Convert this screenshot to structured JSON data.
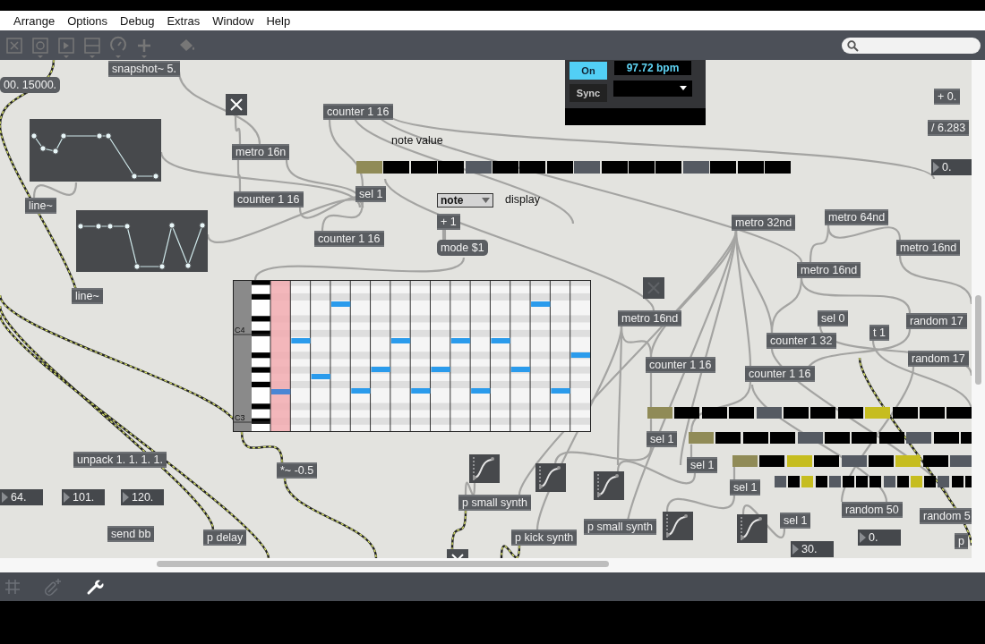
{
  "menu": [
    "Arrange",
    "Options",
    "Debug",
    "Extras",
    "Window",
    "Help"
  ],
  "transport": {
    "buttons": [
      {
        "label": "On",
        "selected": true
      },
      {
        "label": "Sync",
        "selected": false
      }
    ],
    "tempo": "97.72 bpm"
  },
  "comments": [
    "note value",
    "display"
  ],
  "umenu": {
    "value": "note"
  },
  "objects": [
    {
      "kind": "object",
      "text": "snapshot~ 5."
    },
    {
      "kind": "message",
      "text": "00. 15000."
    },
    {
      "kind": "object",
      "text": "counter 1 16"
    },
    {
      "kind": "object",
      "text": "metro 16n"
    },
    {
      "kind": "object",
      "text": "counter 1 16"
    },
    {
      "kind": "object",
      "text": "sel 1"
    },
    {
      "kind": "object",
      "text": "line~"
    },
    {
      "kind": "object",
      "text": "counter 1 16"
    },
    {
      "kind": "object",
      "text": "+ 1"
    },
    {
      "kind": "message",
      "text": "mode $1"
    },
    {
      "kind": "object",
      "text": "line~"
    },
    {
      "kind": "object",
      "text": "metro 32nd"
    },
    {
      "kind": "object",
      "text": "metro 64nd"
    },
    {
      "kind": "object",
      "text": "metro 16nd"
    },
    {
      "kind": "object",
      "text": "metro 16nd"
    },
    {
      "kind": "object",
      "text": "metro 16nd"
    },
    {
      "kind": "object",
      "text": "sel 0"
    },
    {
      "kind": "object",
      "text": "random 17"
    },
    {
      "kind": "object",
      "text": "t 1"
    },
    {
      "kind": "object",
      "text": "counter 1 32"
    },
    {
      "kind": "object",
      "text": "random 17"
    },
    {
      "kind": "object",
      "text": "counter 1 16"
    },
    {
      "kind": "object",
      "text": "counter 1 16"
    },
    {
      "kind": "object",
      "text": "sel 1"
    },
    {
      "kind": "object",
      "text": "sel 1"
    },
    {
      "kind": "object",
      "text": "sel 1"
    },
    {
      "kind": "object",
      "text": "sel 1"
    },
    {
      "kind": "object",
      "text": "unpack 1. 1. 1. 1."
    },
    {
      "kind": "object",
      "text": "*~ -0.5"
    },
    {
      "kind": "number",
      "text": "64."
    },
    {
      "kind": "number",
      "text": "101."
    },
    {
      "kind": "number",
      "text": "120."
    },
    {
      "kind": "object",
      "text": "send bb"
    },
    {
      "kind": "object",
      "text": "p delay"
    },
    {
      "kind": "object",
      "text": "p small synth"
    },
    {
      "kind": "object",
      "text": "p kick synth"
    },
    {
      "kind": "object",
      "text": "p small synth"
    },
    {
      "kind": "object",
      "text": "random 50"
    },
    {
      "kind": "object",
      "text": "random 5"
    },
    {
      "kind": "number",
      "text": "0."
    },
    {
      "kind": "number",
      "text": "30."
    },
    {
      "kind": "object",
      "text": "p"
    },
    {
      "kind": "object",
      "text": "+ 0."
    },
    {
      "kind": "object",
      "text": "/ 6.283"
    },
    {
      "kind": "number",
      "text": "0."
    }
  ],
  "toggles": [
    {
      "checked": true
    },
    {
      "checked": false
    },
    {
      "checked": true
    }
  ],
  "piano_roll": {
    "labels": [
      "C4",
      "C3"
    ]
  },
  "step_rows": [
    {
      "cells": [
        {
          "on": false,
          "current": true
        },
        {
          "on": false,
          "current": false
        },
        {
          "on": false,
          "current": false
        },
        {
          "on": false,
          "current": false
        },
        {
          "on": false,
          "current": false
        },
        {
          "on": false,
          "current": false
        },
        {
          "on": false,
          "current": false
        },
        {
          "on": false,
          "current": false
        },
        {
          "on": false,
          "current": false
        },
        {
          "on": false,
          "current": false
        },
        {
          "on": false,
          "current": false
        },
        {
          "on": false,
          "current": false
        },
        {
          "on": false,
          "current": false
        },
        {
          "on": false,
          "current": false
        },
        {
          "on": false,
          "current": false
        },
        {
          "on": false,
          "current": false
        }
      ]
    },
    {
      "cells": [
        {
          "on": false,
          "current": true
        },
        {
          "on": false,
          "current": false
        },
        {
          "on": false,
          "current": false
        },
        {
          "on": false,
          "current": false
        },
        {
          "on": false,
          "current": false
        },
        {
          "on": false,
          "current": false
        },
        {
          "on": false,
          "current": false
        },
        {
          "on": false,
          "current": false
        },
        {
          "on": true,
          "current": false
        },
        {
          "on": false,
          "current": false
        },
        {
          "on": false,
          "current": false
        },
        {
          "on": false,
          "current": false
        }
      ]
    },
    {
      "cells": [
        {
          "on": false,
          "current": true
        },
        {
          "on": false,
          "current": false
        },
        {
          "on": false,
          "current": false
        },
        {
          "on": false,
          "current": false
        },
        {
          "on": false,
          "current": false
        },
        {
          "on": false,
          "current": false
        },
        {
          "on": false,
          "current": false
        },
        {
          "on": false,
          "current": false
        },
        {
          "on": false,
          "current": false
        },
        {
          "on": false,
          "current": false
        },
        {
          "on": false,
          "current": false
        }
      ]
    },
    {
      "cells": [
        {
          "on": false,
          "current": true
        },
        {
          "on": false,
          "current": false
        },
        {
          "on": true,
          "current": false
        },
        {
          "on": false,
          "current": false
        },
        {
          "on": false,
          "current": false
        },
        {
          "on": false,
          "current": false
        },
        {
          "on": true,
          "current": false
        },
        {
          "on": false,
          "current": false
        },
        {
          "on": false,
          "current": false
        }
      ]
    },
    {
      "cells": [
        {
          "on": false,
          "current": false
        },
        {
          "on": false,
          "current": false
        },
        {
          "on": true,
          "current": false
        },
        {
          "on": false,
          "current": false
        },
        {
          "on": false,
          "current": false
        },
        {
          "on": false,
          "current": false
        },
        {
          "on": false,
          "current": false
        },
        {
          "on": false,
          "current": false
        },
        {
          "on": false,
          "current": false
        },
        {
          "on": false,
          "current": false
        },
        {
          "on": true,
          "current": false
        },
        {
          "on": false,
          "current": false
        },
        {
          "on": false,
          "current": false
        },
        {
          "on": false,
          "current": false
        },
        {
          "on": false,
          "current": false
        }
      ]
    }
  ]
}
